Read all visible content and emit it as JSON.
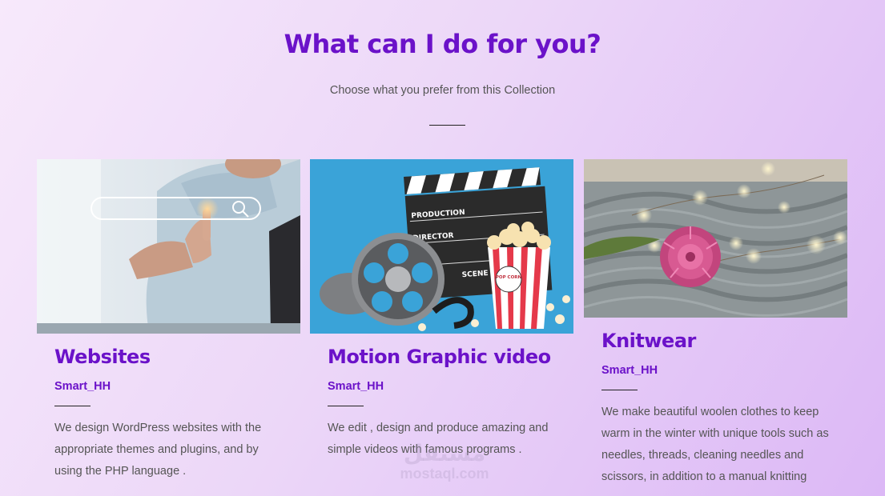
{
  "section": {
    "title": "What can I do for you?",
    "subtitle": "Choose what you prefer from this Collection"
  },
  "cards": [
    {
      "title": "Websites",
      "author": "Smart_HH",
      "description": "We design WordPress websites with the appropriate themes and plugins, and by using the PHP language ."
    },
    {
      "title": "Motion Graphic video",
      "author": "Smart_HH",
      "description": "We edit , design and produce amazing and simple videos with famous programs ."
    },
    {
      "title": "Knitwear",
      "author": "Smart_HH",
      "description": "We make beautiful woolen clothes to keep warm in the winter with unique tools such as needles, threads, cleaning needles and scissors, in addition to a manual knitting"
    }
  ],
  "clapper": {
    "row1": "PRODUCTION",
    "row2": "DIRECTOR",
    "row3": "SCENE"
  },
  "popcorn_label": "POP CORN",
  "watermark": {
    "arabic": "مستقل",
    "latin": "mostaql.com"
  },
  "colors": {
    "accent": "#6b12c9",
    "text": "#555555"
  }
}
